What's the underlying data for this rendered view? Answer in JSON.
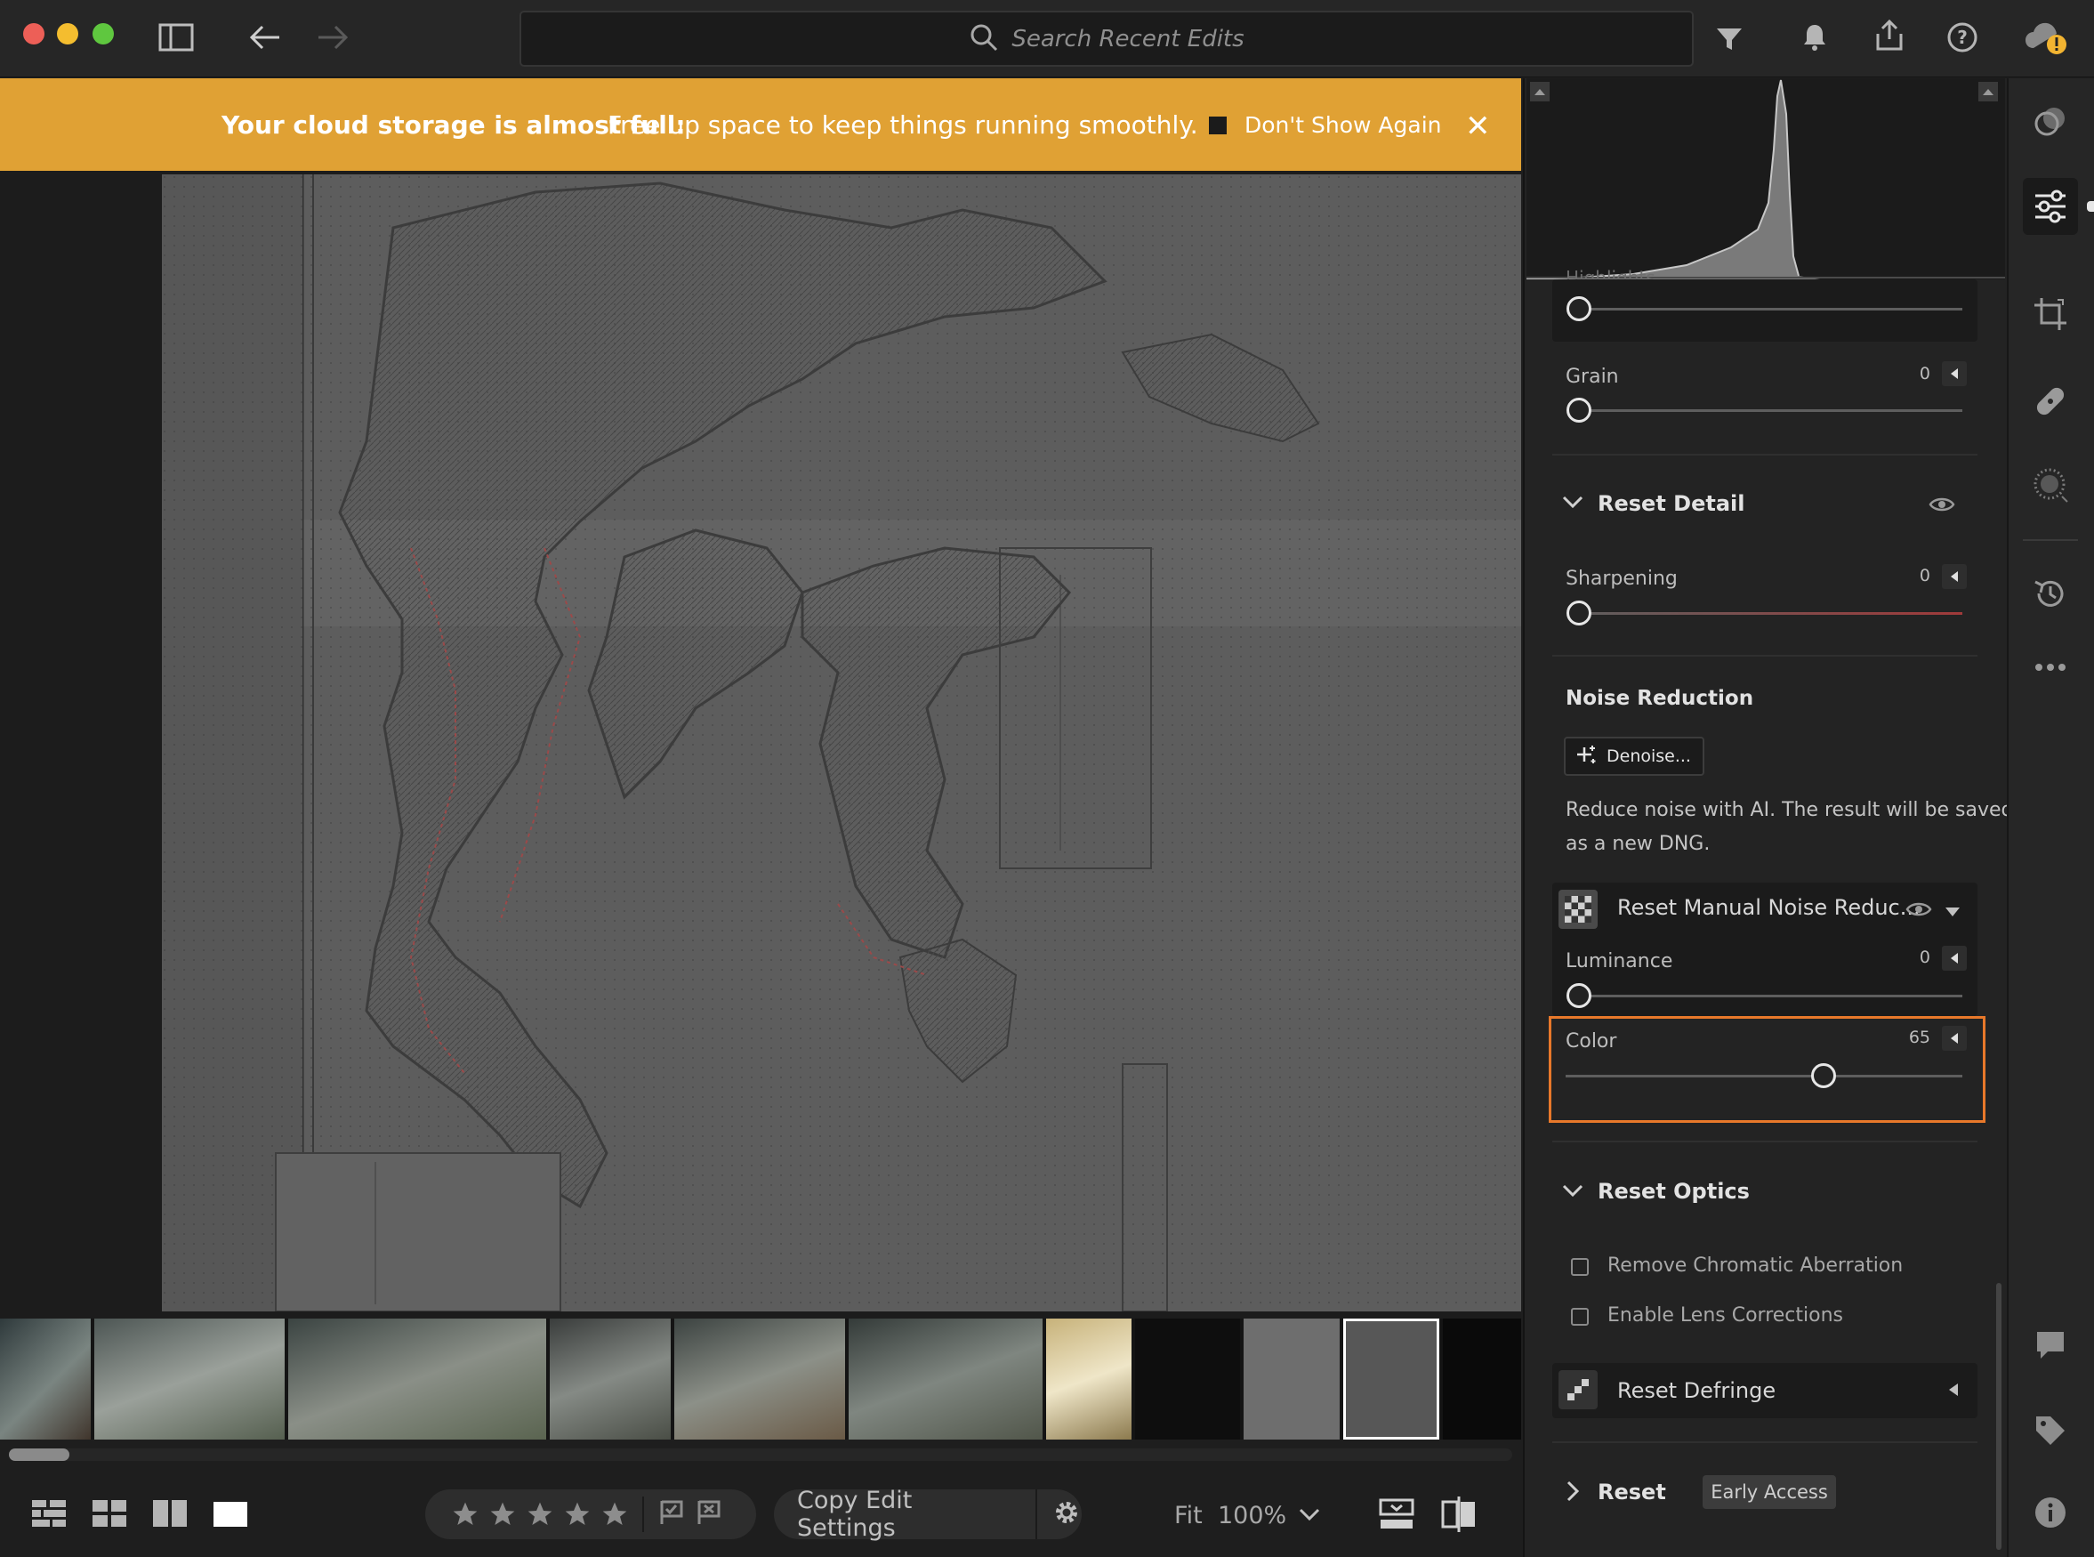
{
  "titlebar": {
    "search_placeholder": "Search Recent Edits"
  },
  "banner": {
    "strong": "Your cloud storage is almost full:",
    "message": "Free up space to keep things running smoothly.",
    "dont_show": "Don't Show Again",
    "close": "✕"
  },
  "panel": {
    "highlights_label": "Highlights",
    "grain_label": "Grain",
    "grain_value": "0",
    "detail_heading": "Reset Detail",
    "sharpening_label": "Sharpening",
    "sharpening_value": "0",
    "noise_heading": "Noise Reduction",
    "denoise_button": "Denoise...",
    "noise_desc_1": "Reduce noise with AI. The result will be saved",
    "noise_desc_2": "as a new DNG.",
    "manual_heading": "Reset Manual Noise Reduc...",
    "luminance_label": "Luminance",
    "luminance_value": "0",
    "color_label": "Color",
    "color_value": "65",
    "color_level": 65,
    "optics_heading": "Reset Optics",
    "chromatic_label": "Remove Chromatic Aberration",
    "lens_label": "Enable Lens Corrections",
    "defringe_heading": "Reset Defringe",
    "reset_heading": "Reset",
    "early_access": "Early Access"
  },
  "bottombar": {
    "copy_edit": "Copy Edit Settings",
    "fit": "Fit",
    "zoom": "100%"
  },
  "colors": {
    "banner": "#e0a134",
    "highlight_box": "#e8782a",
    "sharpening_track": "#a03a3a"
  }
}
